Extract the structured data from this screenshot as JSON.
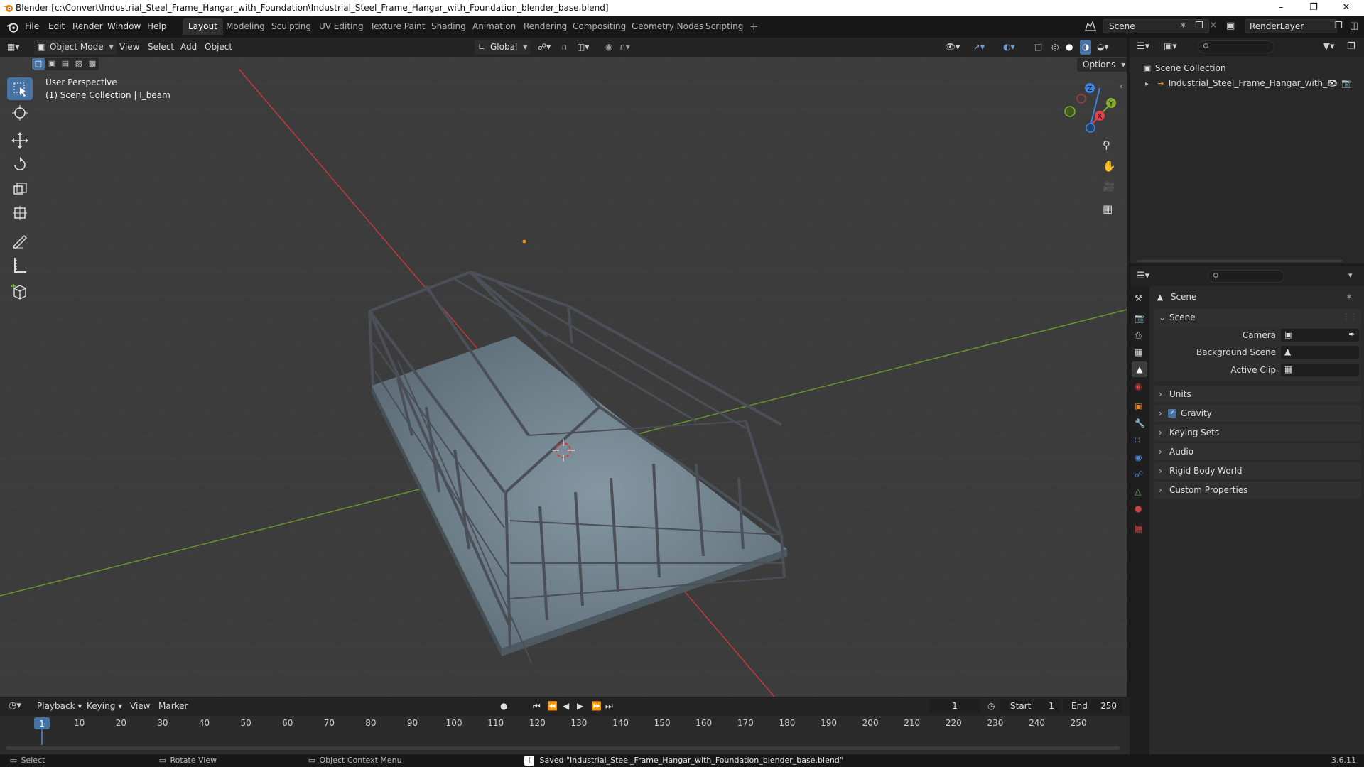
{
  "window": {
    "title": "Blender [c:\\Convert\\Industrial_Steel_Frame_Hangar_with_Foundation\\Industrial_Steel_Frame_Hangar_with_Foundation_blender_base.blend]"
  },
  "menu": {
    "items": [
      "File",
      "Edit",
      "Render",
      "Window",
      "Help"
    ]
  },
  "workspaces": {
    "tabs": [
      "Layout",
      "Modeling",
      "Sculpting",
      "UV Editing",
      "Texture Paint",
      "Shading",
      "Animation",
      "Rendering",
      "Compositing",
      "Geometry Nodes",
      "Scripting"
    ],
    "active": "Layout",
    "add_symbol": "+"
  },
  "scene_selector": {
    "value": "Scene"
  },
  "renderlayer_selector": {
    "value": "RenderLayer"
  },
  "viewport": {
    "mode": "Object Mode",
    "menus": [
      "View",
      "Select",
      "Add",
      "Object"
    ],
    "transform_orientation": "Global",
    "options_label": "Options",
    "perspective_label": "User Perspective",
    "collection_label": "(1) Scene Collection | I_beam",
    "gizmo_axes": {
      "x": "X",
      "y": "Y",
      "z": "Z"
    },
    "colors": {
      "background": "#3c3c3c",
      "x_axis": "#c8383c",
      "y_axis": "#6c9a2a",
      "x_gizmo": "#e2404e",
      "y_gizmo": "#86ab2e",
      "z_gizmo": "#3b84e0",
      "active_tool": "#4672a4"
    }
  },
  "tools": [
    "select-box-tool",
    "cursor-tool",
    "move-tool",
    "rotate-tool",
    "scale-tool",
    "transform-tool",
    "annotate-tool",
    "measure-tool",
    "add-cube-tool"
  ],
  "outliner": {
    "root": "Scene Collection",
    "items": [
      {
        "label": "Industrial_Steel_Frame_Hangar_with_Fc",
        "icon": "empty-axes-icon"
      }
    ]
  },
  "properties": {
    "context_title": "Scene",
    "panel_scene": {
      "label": "Scene",
      "camera_label": "Camera",
      "background_scene_label": "Background Scene",
      "active_clip_label": "Active Clip"
    },
    "panels": [
      {
        "label": "Units",
        "checkbox": false
      },
      {
        "label": "Gravity",
        "checkbox": true
      },
      {
        "label": "Keying Sets",
        "checkbox": false
      },
      {
        "label": "Audio",
        "checkbox": false
      },
      {
        "label": "Rigid Body World",
        "checkbox": false
      },
      {
        "label": "Custom Properties",
        "checkbox": false
      }
    ]
  },
  "timeline": {
    "menus": [
      "Playback",
      "Keying",
      "View",
      "Marker"
    ],
    "current_frame": "1",
    "start_label": "Start",
    "start_value": "1",
    "end_label": "End",
    "end_value": "250",
    "ruler_ticks": [
      "1",
      "10",
      "20",
      "30",
      "40",
      "50",
      "60",
      "70",
      "80",
      "90",
      "100",
      "110",
      "120",
      "130",
      "140",
      "150",
      "160",
      "170",
      "180",
      "190",
      "200",
      "210",
      "220",
      "230",
      "240",
      "250"
    ]
  },
  "statusbar": {
    "select_label": "Select",
    "rotate_label": "Rotate View",
    "context_menu_label": "Object Context Menu",
    "message": "Saved \"Industrial_Steel_Frame_Hangar_with_Foundation_blender_base.blend\"",
    "version": "3.6.11"
  }
}
